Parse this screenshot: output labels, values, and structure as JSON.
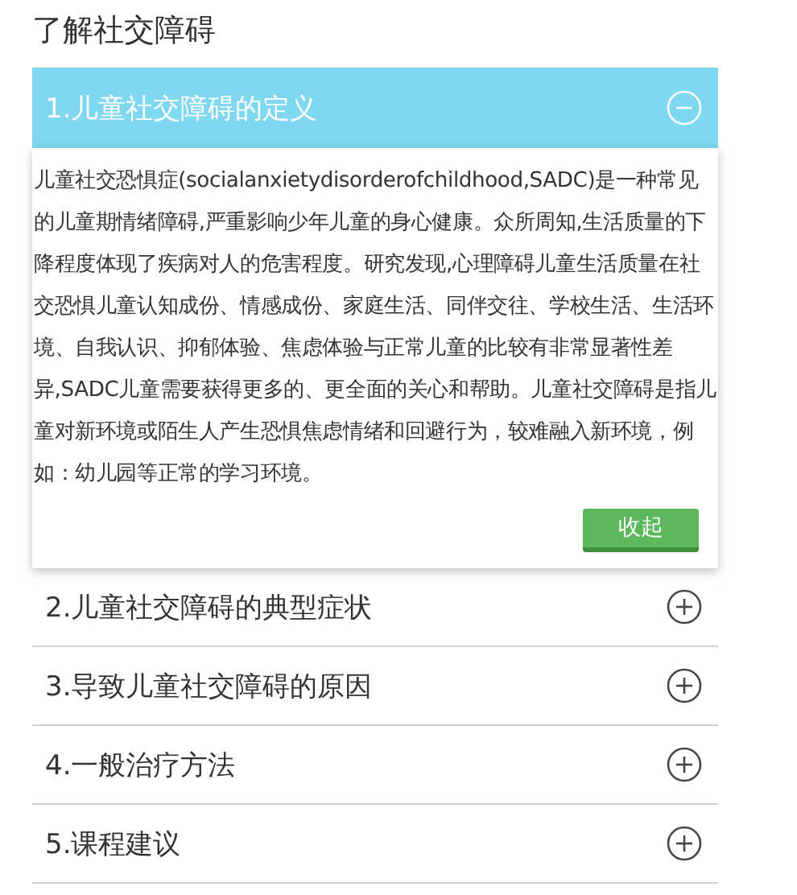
{
  "title": "了解社交障碍",
  "sections": [
    {
      "label": "1.儿童社交障碍的定义",
      "expanded": true,
      "body": "儿童社交恐惧症(socialanxietydisorderofchildhood,SADC)是一种常见的儿童期情绪障碍,严重影响少年儿童的身心健康。众所周知,生活质量的下降程度体现了疾病对人的危害程度。研究发现,心理障碍儿童生活质量在社交恐惧儿童认知成份、情感成份、家庭生活、同伴交往、学校生活、生活环境、自我认识、抑郁体验、焦虑体验与正常儿童的比较有非常显著性差异,SADC儿童需要获得更多的、更全面的关心和帮助。儿童社交障碍是指儿童对新环境或陌生人产生恐惧焦虑情绪和回避行为，较难融入新环境，例如：幼儿园等正常的学习环境。",
      "button": "收起"
    },
    {
      "label": "2.儿童社交障碍的典型症状",
      "expanded": false
    },
    {
      "label": "3.导致儿童社交障碍的原因",
      "expanded": false
    },
    {
      "label": "4.一般治疗方法",
      "expanded": false
    },
    {
      "label": "5.课程建议",
      "expanded": false
    }
  ]
}
